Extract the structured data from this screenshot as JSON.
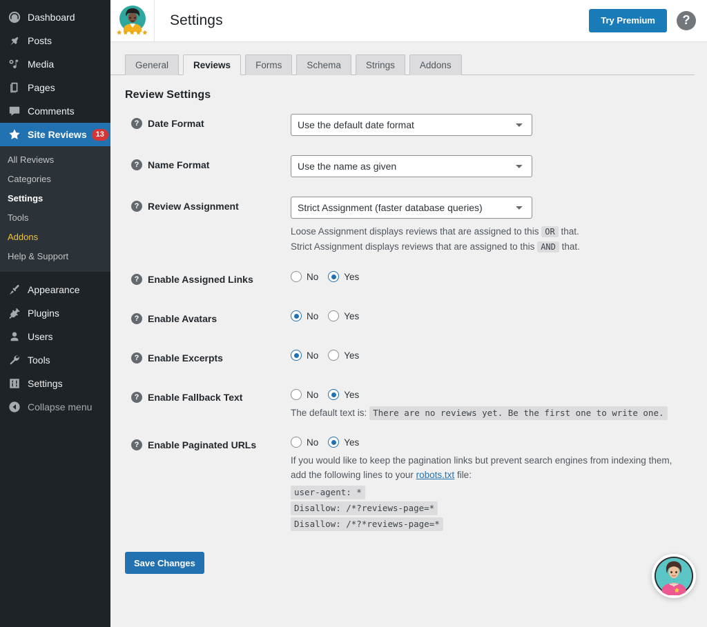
{
  "sidebar": {
    "items": [
      {
        "label": "Dashboard",
        "icon": "dashboard-icon"
      },
      {
        "label": "Posts",
        "icon": "pin-icon"
      },
      {
        "label": "Media",
        "icon": "media-icon"
      },
      {
        "label": "Pages",
        "icon": "pages-icon"
      },
      {
        "label": "Comments",
        "icon": "comments-icon"
      },
      {
        "label": "Site Reviews",
        "icon": "star-icon",
        "badge": "13",
        "current": true
      }
    ],
    "submenu": [
      {
        "label": "All Reviews"
      },
      {
        "label": "Categories"
      },
      {
        "label": "Settings",
        "active": true
      },
      {
        "label": "Tools"
      },
      {
        "label": "Addons",
        "highlight": true
      },
      {
        "label": "Help & Support"
      }
    ],
    "items_bottom": [
      {
        "label": "Appearance",
        "icon": "paintbrush-icon"
      },
      {
        "label": "Plugins",
        "icon": "plug-icon"
      },
      {
        "label": "Users",
        "icon": "user-icon"
      },
      {
        "label": "Tools",
        "icon": "wrench-icon"
      },
      {
        "label": "Settings",
        "icon": "sliders-icon"
      },
      {
        "label": "Collapse menu",
        "icon": "collapse-icon"
      }
    ]
  },
  "header": {
    "title": "Settings",
    "premium_button": "Try Premium",
    "help_glyph": "?",
    "logo_name": "site-reviews-logo"
  },
  "tabs": [
    {
      "label": "General",
      "active": false
    },
    {
      "label": "Reviews",
      "active": true
    },
    {
      "label": "Forms",
      "active": false
    },
    {
      "label": "Schema",
      "active": false
    },
    {
      "label": "Strings",
      "active": false
    },
    {
      "label": "Addons",
      "active": false
    }
  ],
  "content": {
    "section_title": "Review Settings",
    "fields": {
      "date_format": {
        "label": "Date Format",
        "value": "Use the default date format",
        "options": [
          "Use the default date format"
        ]
      },
      "name_format": {
        "label": "Name Format",
        "value": "Use the name as given",
        "options": [
          "Use the name as given"
        ]
      },
      "review_assignment": {
        "label": "Review Assignment",
        "value": "Strict Assignment (faster database queries)",
        "options": [
          "Strict Assignment (faster database queries)"
        ],
        "desc_line1_a": "Loose Assignment displays reviews that are assigned to this",
        "desc_line1_code": "OR",
        "desc_line1_b": "that.",
        "desc_line2_a": "Strict Assignment displays reviews that are assigned to this",
        "desc_line2_code": "AND",
        "desc_line2_b": "that."
      },
      "assigned_links": {
        "label": "Enable Assigned Links",
        "no_label": "No",
        "yes_label": "Yes",
        "selected": "Yes"
      },
      "avatars": {
        "label": "Enable Avatars",
        "no_label": "No",
        "yes_label": "Yes",
        "selected": "No"
      },
      "excerpts": {
        "label": "Enable Excerpts",
        "no_label": "No",
        "yes_label": "Yes",
        "selected": "No"
      },
      "fallback_text": {
        "label": "Enable Fallback Text",
        "no_label": "No",
        "yes_label": "Yes",
        "selected": "Yes",
        "desc_prefix": "The default text is:",
        "desc_code": "There are no reviews yet. Be the first one to write one."
      },
      "paginated_urls": {
        "label": "Enable Paginated URLs",
        "no_label": "No",
        "yes_label": "Yes",
        "selected": "Yes",
        "desc_a": "If you would like to keep the pagination links but prevent search engines from indexing them, add the following lines to your",
        "desc_link": "robots.txt",
        "desc_b": "file:",
        "code_line1": "user-agent: *",
        "code_line2": "Disallow: /*?reviews-page=*",
        "code_line3": "Disallow: /*?*reviews-page=*"
      }
    },
    "save_button": "Save Changes"
  },
  "support_fab": {
    "name": "support-chat-avatar"
  },
  "colors": {
    "sidebar_bg": "#1d2327",
    "submenu_bg": "#2c3338",
    "accent_blue": "#2271b1",
    "premium_blue": "#1a7bb9",
    "badge_red": "#d63638",
    "addons_yellow": "#f0c33c",
    "page_bg": "#f0f0f1",
    "code_bg": "#dcdcde"
  }
}
